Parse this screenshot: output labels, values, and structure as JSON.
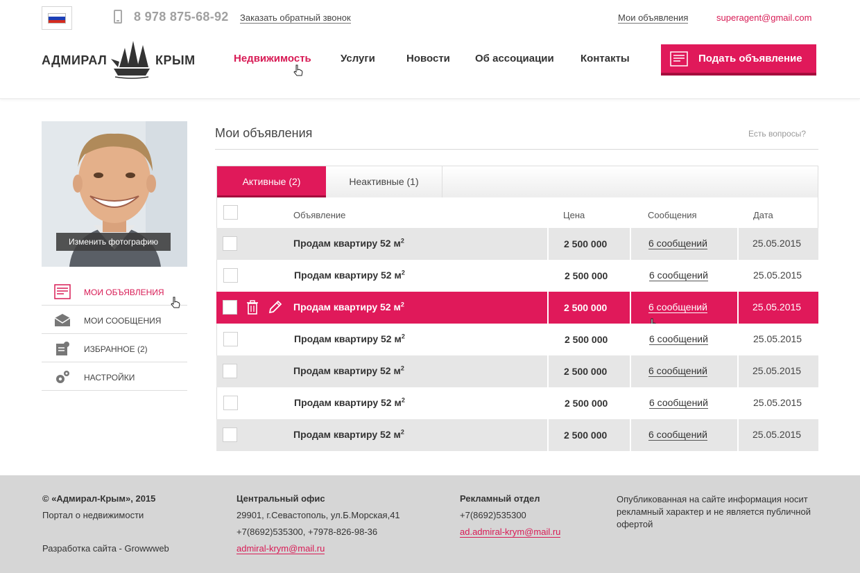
{
  "header": {
    "phone": "8 978 875-68-92",
    "callback_label": "Заказать обратный звонок",
    "my_ads_label": "Мои объявления",
    "user_email": "superagent@gmail.com",
    "logo_left": "АДМИРАЛ",
    "logo_right": "КРЫМ",
    "nav": [
      "Недвижимость",
      "Услуги",
      "Новости",
      "Об ассоциации",
      "Контакты"
    ],
    "post_button": "Подать объявление",
    "accent_color": "#e0195a"
  },
  "sidebar": {
    "photo_button": "Изменить фотографию",
    "items": [
      {
        "label": "Мои объявления",
        "icon": "listing-icon",
        "active": true
      },
      {
        "label": "Мои сообщения",
        "icon": "envelope-icon"
      },
      {
        "label": "Избранное (2)",
        "icon": "favorites-icon"
      },
      {
        "label": "Настройки",
        "icon": "gears-icon"
      }
    ]
  },
  "main": {
    "title": "Мои объявления",
    "questions": "Есть вопросы?",
    "tabs": [
      {
        "label": "Активные (2)",
        "active": true
      },
      {
        "label": "Неактивные (1)"
      }
    ],
    "columns": {
      "title": "Объявление",
      "price": "Цена",
      "messages": "Сообщения",
      "date": "Дата"
    },
    "rows": [
      {
        "title": "Продам квартиру 52 м",
        "sup": "2",
        "price": "2 500 000",
        "messages": "6 сообщений",
        "date": "25.05.2015"
      },
      {
        "title": "Продам квартиру 52 м",
        "sup": "2",
        "price": "2 500 000",
        "messages": "6 сообщений",
        "date": "25.05.2015"
      },
      {
        "title": "Продам квартиру 52 м",
        "sup": "2",
        "price": "2 500 000",
        "messages": "6 сообщений",
        "date": "25.05.2015",
        "selected": true
      },
      {
        "title": "Продам квартиру 52 м",
        "sup": "2",
        "price": "2 500 000",
        "messages": "6 сообщений",
        "date": "25.05.2015"
      },
      {
        "title": "Продам квартиру 52 м",
        "sup": "2",
        "price": "2 500 000",
        "messages": "6 сообщений",
        "date": "25.05.2015"
      },
      {
        "title": "Продам квартиру 52 м",
        "sup": "2",
        "price": "2 500 000",
        "messages": "6 сообщений",
        "date": "25.05.2015"
      },
      {
        "title": "Продам квартиру 52 м",
        "sup": "2",
        "price": "2 500 000",
        "messages": "6 сообщений",
        "date": "25.05.2015"
      }
    ]
  },
  "footer": {
    "copyright": "© «Адмирал-Крым», 2015",
    "portal": "Портал о недвижимости",
    "developer": "Разработка сайта - Growwweb",
    "office_title": "Центральный офис",
    "office_address": "29901, г.Севастополь, ул.Б.Морская,41",
    "office_phones": "+7(8692)535300, +7978-826-98-36",
    "office_email": "admiral-krym@mail.ru",
    "ads_title": "Рекламный отдел",
    "ads_phone": "+7(8692)535300",
    "ads_email": "ad.admiral-krym@mail.ru",
    "disclaimer": "Опубликованная на сайте информация носит рекламный характер и не является публичной офертой"
  }
}
